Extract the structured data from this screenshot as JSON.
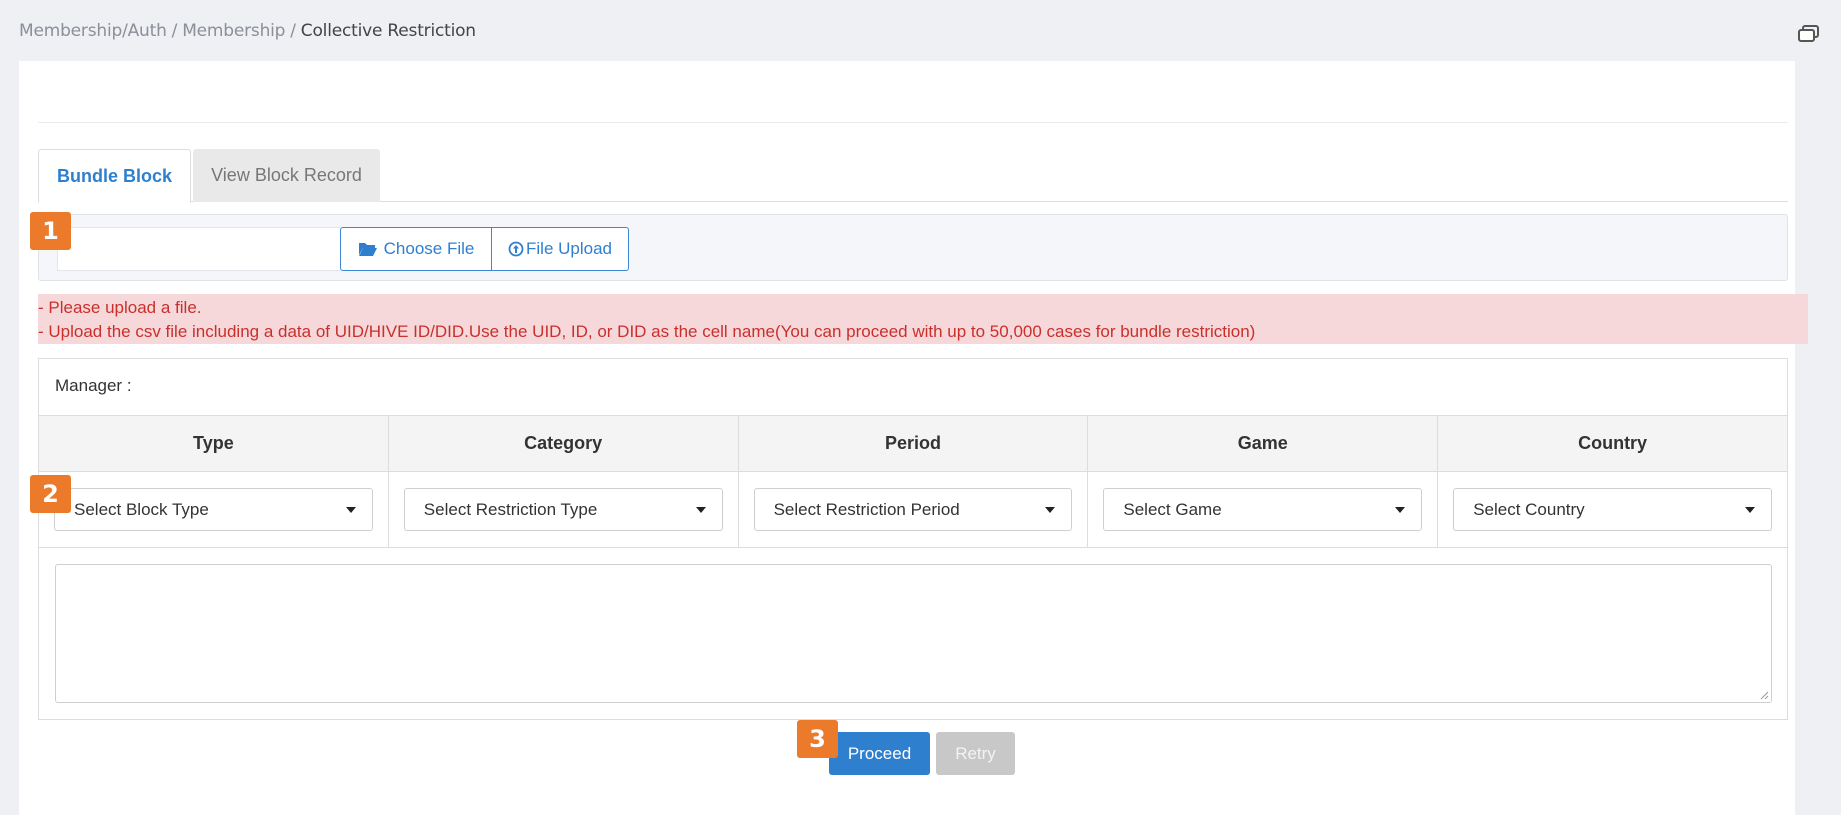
{
  "breadcrumb": {
    "item1": "Membership/Auth",
    "item2": "Membership",
    "current": "Collective Restriction",
    "separator": "/"
  },
  "icons": {
    "window": "window-restore-icon",
    "folder": "folder-open-icon",
    "upload": "upload-circle-icon",
    "caret": "caret-down-icon"
  },
  "tabs": [
    {
      "label": "Bundle Block",
      "active": true
    },
    {
      "label": "View Block Record",
      "active": false
    }
  ],
  "upload": {
    "file_value": "",
    "choose_label": "Choose File",
    "upload_label": "File Upload"
  },
  "alert": {
    "line1": "- Please upload a file.",
    "line2": "- Upload the csv file including a data of UID/HIVE ID/DID.Use the UID, ID, or DID as the cell name(You can proceed with up to 50,000 cases for bundle restriction)"
  },
  "form": {
    "manager_label": "Manager :",
    "columns": [
      "Type",
      "Category",
      "Period",
      "Game",
      "Country"
    ],
    "selects": [
      "Select Block Type",
      "Select Restriction Type",
      "Select Restriction Period",
      "Select Game",
      "Select Country"
    ],
    "textarea_value": ""
  },
  "actions": {
    "proceed_label": "Proceed",
    "retry_label": "Retry"
  },
  "markers": [
    "1",
    "2",
    "3"
  ],
  "colors": {
    "accent": "#2f7fcf",
    "alert_bg": "#f6d8da",
    "alert_text": "#c9302c",
    "marker": "#ec7a2b",
    "retry_bg": "#c8c8c8"
  }
}
